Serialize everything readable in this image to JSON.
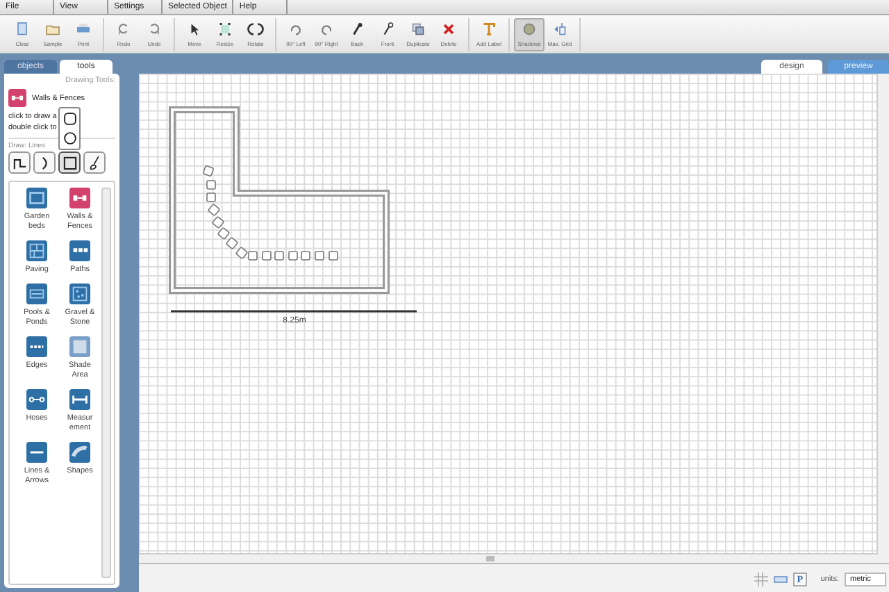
{
  "menu": [
    "File",
    "View",
    "Settings",
    "Selected Object",
    "Help"
  ],
  "toolbar": [
    {
      "label": "Clear",
      "on": false
    },
    {
      "label": "Sample",
      "on": false
    },
    {
      "label": "Print",
      "on": false
    },
    {
      "label": "Redo",
      "on": false
    },
    {
      "label": "Undo",
      "on": false
    },
    {
      "label": "Move",
      "on": false
    },
    {
      "label": "Resize",
      "on": false
    },
    {
      "label": "Rotate",
      "on": false
    },
    {
      "label": "90° Left",
      "on": false
    },
    {
      "label": "90° Right",
      "on": false
    },
    {
      "label": "Back",
      "on": false
    },
    {
      "label": "Front",
      "on": false
    },
    {
      "label": "Duplicate",
      "on": false
    },
    {
      "label": "Delete",
      "on": false
    },
    {
      "label": "Add Label",
      "on": false
    },
    {
      "label": "Shadows",
      "on": true
    },
    {
      "label": "Max. Grid",
      "on": false
    }
  ],
  "panel_tabs": [
    {
      "label": "objects",
      "selected": false
    },
    {
      "label": "tools",
      "selected": true
    }
  ],
  "drawing_tools": {
    "heading": "Drawing Tools:",
    "current_tool": "Walls & Fences",
    "hint_lines": [
      "click to draw a",
      "double click to"
    ],
    "draw_label": "Draw: Lines",
    "modes": [
      {
        "kind": "step",
        "selected": false
      },
      {
        "kind": "curve",
        "selected": false
      },
      {
        "kind": "square",
        "selected": true
      },
      {
        "kind": "brush",
        "selected": false
      }
    ],
    "shape_options": [
      {
        "kind": "rounded"
      },
      {
        "kind": "circle"
      }
    ]
  },
  "tools": [
    {
      "label": "Garden beds"
    },
    {
      "label": "Walls & Fences"
    },
    {
      "label": "Paving"
    },
    {
      "label": "Paths"
    },
    {
      "label": "Pools & Ponds"
    },
    {
      "label": "Gravel & Stone"
    },
    {
      "label": "Edges"
    },
    {
      "label": "Shade Area"
    },
    {
      "label": "Hoses"
    },
    {
      "label": "Measur ement"
    },
    {
      "label": "Lines & Arrows"
    },
    {
      "label": "Shapes"
    }
  ],
  "view_tabs": [
    {
      "label": "design",
      "selected": true
    },
    {
      "label": "preview",
      "selected": false
    }
  ],
  "canvas": {
    "scale_label": "8.25m"
  },
  "status_bar": {
    "p_button": "P",
    "units_label": "units:",
    "units_value": "metric"
  }
}
